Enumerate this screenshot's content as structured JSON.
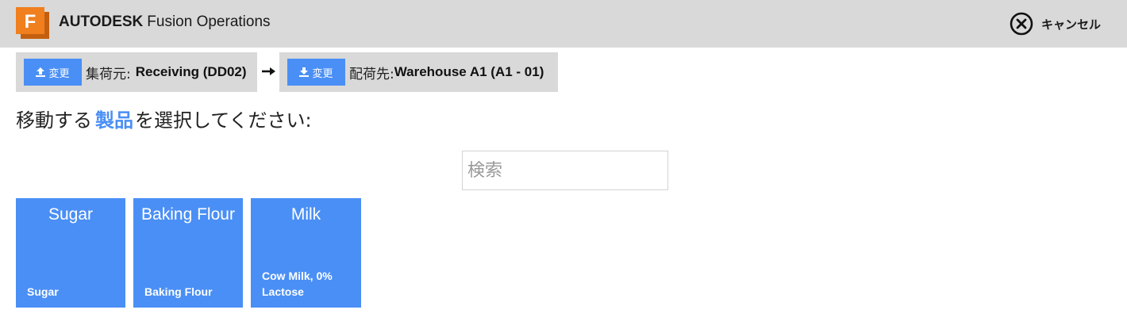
{
  "header": {
    "brand_bold": "AUTODESK",
    "brand_product": "Fusion Operations",
    "logo_letter": "F",
    "cancel_label": "キャンセル",
    "cancel_icon": "close-circle-icon"
  },
  "transfer": {
    "source": {
      "button_label": "変更",
      "button_icon": "upload-icon",
      "label": "集荷元:",
      "value": "Receiving (DD02)"
    },
    "arrow_icon": "arrow-right-icon",
    "destination": {
      "button_label": "変更",
      "button_icon": "download-icon",
      "label": "配荷先:",
      "value": "Warehouse A1 (A1 - 01)"
    }
  },
  "prompt": {
    "before": "移動する",
    "highlight": "製品",
    "after": "を選択してください:"
  },
  "search": {
    "placeholder": "検索",
    "value": ""
  },
  "products": [
    {
      "name": "Sugar",
      "description": "Sugar"
    },
    {
      "name": "Baking Flour",
      "description": "Baking Flour"
    },
    {
      "name": "Milk",
      "description": "Cow Milk, 0% Lactose"
    }
  ],
  "colors": {
    "accent": "#4a8ff5",
    "header_bg": "#d9d9d9",
    "logo_orange": "#f07f1e"
  }
}
